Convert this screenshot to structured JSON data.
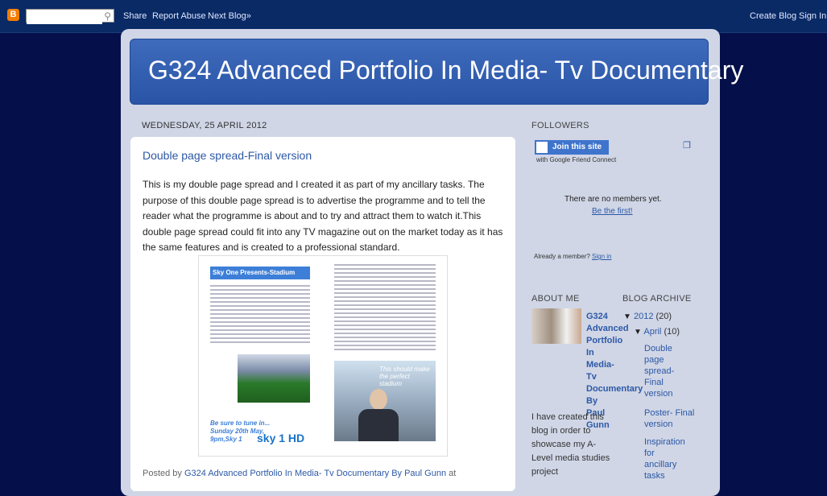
{
  "navbar": {
    "search_placeholder": "",
    "links": [
      "Share",
      "Report Abuse",
      "Next Blog»"
    ],
    "right_links": [
      "Create Blog",
      "Sign In"
    ]
  },
  "blog": {
    "title": "G324 Advanced Portfolio In Media- Tv Documentary"
  },
  "post": {
    "date": "WEDNESDAY, 25 APRIL 2012",
    "title": "Double page spread-Final version",
    "body": "This is my double page spread and I created it as part of my ancillary tasks. The purpose of this double page spread is to advertise the programme and to tell the reader what the programme is about and to try and attract them to watch it.This double page spread could fit into any TV magazine out on the market today as it has the same features and is created to a professional standard.",
    "image": {
      "heading": "Sky One Presents-Stadium Watch",
      "quote": "This should make the perfect stadium",
      "tune_in": "Be sure to tune in... Sunday 20th May, 9pm,Sky 1",
      "logo": "sky 1 HD"
    },
    "posted_by_prefix": "Posted by",
    "posted_by_author": "G324 Advanced Portfolio In Media- Tv Documentary By Paul Gunn",
    "posted_by_suffix": "at"
  },
  "sidebar": {
    "followers": {
      "title": "FOLLOWERS",
      "join_button": "Join this site",
      "gfc_text": "with Google Friend Connect",
      "no_members": "There are no members yet.",
      "be_first": "Be the first!",
      "already_member": "Already a member?",
      "sign_in": "Sign in"
    },
    "about": {
      "title": "ABOUT ME",
      "name_first": "G324",
      "name_rest": "Advanced Portfolio In Media- Tv Documentary By Paul Gunn",
      "text": "I have created this blog in order to showcase my A-Level media studies project"
    },
    "archive": {
      "title": "BLOG ARCHIVE",
      "year": "2012",
      "year_count": "(20)",
      "month": "April",
      "month_count": "(10)",
      "posts": [
        "Double page spread-Final version",
        "Poster- Final version",
        "Inspiration for ancillary tasks"
      ]
    }
  }
}
